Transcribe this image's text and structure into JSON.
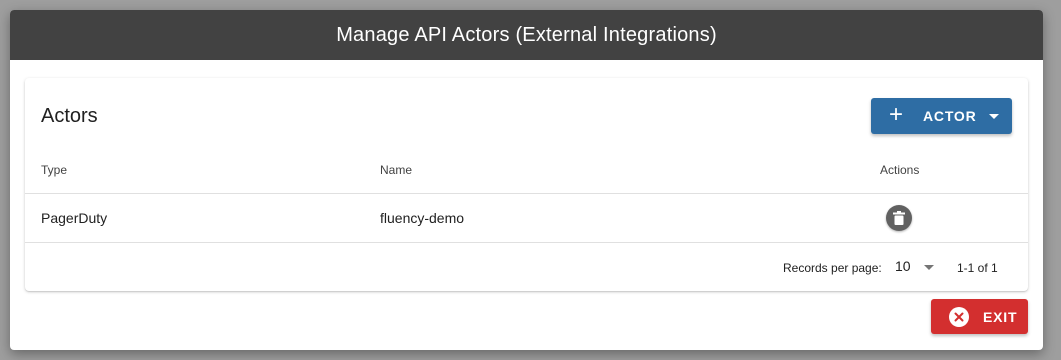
{
  "dialog": {
    "title": "Manage API Actors (External Integrations)",
    "exit_label": "EXIT"
  },
  "card": {
    "title": "Actors",
    "add_button_label": "ACTOR",
    "add_button_icon": "plus-icon"
  },
  "table": {
    "columns": [
      "Type",
      "Name",
      "Actions"
    ],
    "rows": [
      {
        "type": "PagerDuty",
        "name": "fluency-demo",
        "action_icon": "trash-icon"
      }
    ]
  },
  "pagination": {
    "records_per_page_label": "Records per page:",
    "records_per_page_value": "10",
    "range_text": "1-1 of 1"
  },
  "colors": {
    "header_bg": "#424242",
    "primary": "#2e6da4",
    "danger": "#d32f2f"
  }
}
